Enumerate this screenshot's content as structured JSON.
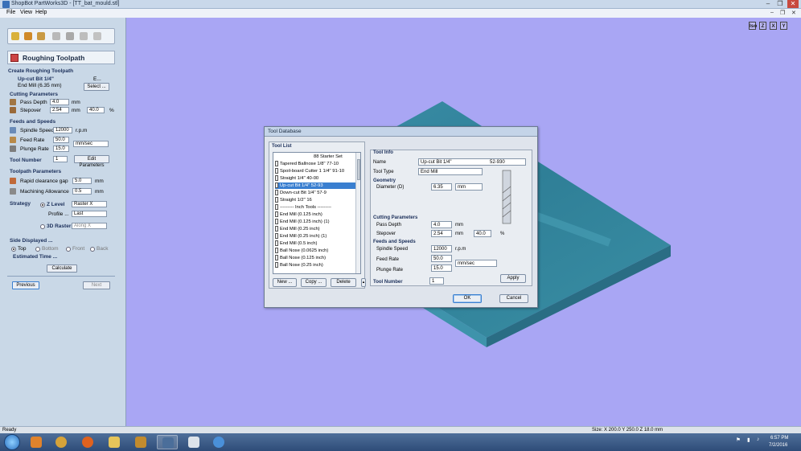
{
  "window": {
    "title": "ShopBot PartWorks3D - [TT_bat_mould.stl]",
    "controls": {
      "minimize": "–",
      "restore": "❐",
      "close": "✕"
    }
  },
  "menu": {
    "items": [
      "File",
      "View",
      "Help"
    ],
    "right_controls": {
      "minimize": "–",
      "restore": "❐",
      "close": "✕"
    }
  },
  "left_panel": {
    "header": "Roughing Toolpath",
    "create_label": "Create Roughing Toolpath",
    "tool_name": "Up-cut Bit 1/4\"",
    "tool_type": "End Mill (6.35 mm)",
    "edit_button": "E...",
    "select_button": "Select ...",
    "cutting_parameters": {
      "label": "Cutting Parameters",
      "pass_depth_label": "Pass Depth",
      "pass_depth": "4.0",
      "pass_depth_unit": "mm",
      "stepover_label": "Stepover",
      "stepover": "2.54",
      "stepover_unit": "mm",
      "stepover_pct": "40.0",
      "pct": "%"
    },
    "feeds_speeds": {
      "label": "Feeds and Speeds",
      "spindle_label": "Spindle Speed",
      "spindle": "12000",
      "spindle_unit": "r.p.m",
      "feed_label": "Feed Rate",
      "feed": "50.0",
      "plunge_label": "Plunge Rate",
      "plunge": "15.0",
      "rate_unit": "mm/sec"
    },
    "tool_number_label": "Tool Number",
    "tool_number": "1",
    "edit_params_button": "Edit Parameters",
    "toolpath_parameters": {
      "label": "Toolpath Parameters",
      "rapid_label": "Rapid clearance gap",
      "rapid": "5.0",
      "rapid_unit": "mm",
      "allowance_label": "Machining Allowance",
      "allowance": "0.5",
      "allowance_unit": "mm"
    },
    "strategy": {
      "label": "Strategy",
      "zlevel_label": "Z Level",
      "zlevel_value": "Raster X",
      "profile_label": "Profile ...",
      "profile_value": "Last",
      "raster3d_label": "3D Raster",
      "raster3d_value": "Along X"
    },
    "side": {
      "label": "Side Displayed ...",
      "options": [
        "Top",
        "Bottom",
        "Front",
        "Back"
      ]
    },
    "estimated_label": "Estimated Time ...",
    "calculate_button": "Calculate",
    "previous_button": "Previous",
    "next_button": "Next"
  },
  "viewport": {
    "view_icons": [
      "Iso",
      "Z",
      "X",
      "Y"
    ]
  },
  "tool_database": {
    "title": "Tool Database",
    "list_label": "Tool List",
    "list_items": [
      "88 Starter Set",
      "Tapered Ballnose 1/8\"   77-10",
      "Spoil-board Cutter 1 1/4\"   91-10",
      "Straight 1/4\"   40-00",
      "Up-cut Bit 1/4\"   52-93",
      "Down-cut Bit 1/4\"   57-9",
      "Straight 1/2\"   16",
      "--------- Inch Tools ---------",
      "End Mill (0.125 inch)",
      "End Mill (0.125 inch) (1)",
      "End Mill (0.25 inch)",
      "End Mill (0.25 inch) (1)",
      "End Mill (0.5 inch)",
      "Ball Nose (0.0625 inch)",
      "Ball Nose (0.125 inch)",
      "Ball Nose (0.25 inch)"
    ],
    "selected_index": 4,
    "new_button": "New ...",
    "copy_button": "Copy ...",
    "delete_button": "Delete",
    "info_label": "Tool Info",
    "name_label": "Name",
    "name_value": "Up-cut Bit 1/4\"",
    "name_code": "52-930",
    "type_label": "Tool Type",
    "type_value": "End Mill",
    "geometry_label": "Geometry",
    "diameter_label": "Diameter (D)",
    "diameter_value": "6.35",
    "diameter_unit": "mm",
    "cutting_label": "Cutting Parameters",
    "pass_depth_label": "Pass Depth",
    "pass_depth": "4.0",
    "pass_unit": "mm",
    "stepover_label": "Stepover",
    "stepover": "2.54",
    "stepover_unit": "mm",
    "stepover_pct": "40.0",
    "pct": "%",
    "feeds_label": "Feeds and Speeds",
    "spindle_label": "Spindle Speed",
    "spindle": "12000",
    "spindle_unit": "r.p.m",
    "feed_label": "Feed Rate",
    "feed": "50.0",
    "plunge_label": "Plunge Rate",
    "plunge": "15.0",
    "rate_unit": "mm/sec",
    "tool_number_label": "Tool Number",
    "tool_number": "1",
    "apply_button": "Apply",
    "ok_button": "OK",
    "cancel_button": "Cancel"
  },
  "status": {
    "left": "Ready",
    "right": "Size: X 200.0 Y 250.0 Z 18.0 mm"
  },
  "taskbar": {
    "time": "6:57 PM",
    "date": "7/2/2016"
  }
}
